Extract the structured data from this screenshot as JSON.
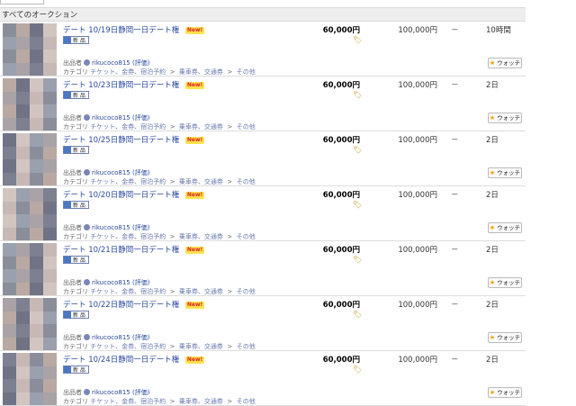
{
  "header": {
    "section_title": "すべてのオークション"
  },
  "items": [
    {
      "title": "デート 10/19日静岡一日デート権",
      "new_badge": "New!",
      "condition_tag": "新 品",
      "seller_prefix": "出品者",
      "seller_name": "rikucoco815",
      "seller_rating": "(評価)",
      "category_prefix": "カテゴリ",
      "category_path": [
        "チケット、金券、宿泊予約",
        "乗車券、交通券",
        "その他"
      ],
      "price": "60,000円",
      "buy_now": "100,000円",
      "bids": "－",
      "remaining": "10時間",
      "watch_label": "ウォッチ"
    },
    {
      "title": "デート 10/23日静岡一日デート権",
      "new_badge": "New!",
      "condition_tag": "新 品",
      "seller_prefix": "出品者",
      "seller_name": "rikucoco815",
      "seller_rating": "(評価)",
      "category_prefix": "カテゴリ",
      "category_path": [
        "チケット、金券、宿泊予約",
        "乗車券、交通券",
        "その他"
      ],
      "price": "60,000円",
      "buy_now": "100,000円",
      "bids": "－",
      "remaining": "2日",
      "watch_label": "ウォッチ"
    },
    {
      "title": "デート 10/25日静岡一日デート権",
      "new_badge": "New!",
      "condition_tag": "新 品",
      "seller_prefix": "出品者",
      "seller_name": "rikucoco815",
      "seller_rating": "(評価)",
      "category_prefix": "カテゴリ",
      "category_path": [
        "チケット、金券、宿泊予約",
        "乗車券、交通券",
        "その他"
      ],
      "price": "60,000円",
      "buy_now": "100,000円",
      "bids": "－",
      "remaining": "2日",
      "watch_label": "ウォッチ"
    },
    {
      "title": "デート 10/20日静岡一日デート権",
      "new_badge": "New!",
      "condition_tag": "新 品",
      "seller_prefix": "出品者",
      "seller_name": "rikucoco815",
      "seller_rating": "(評価)",
      "category_prefix": "カテゴリ",
      "category_path": [
        "チケット、金券、宿泊予約",
        "乗車券、交通券",
        "その他"
      ],
      "price": "60,000円",
      "buy_now": "100,000円",
      "bids": "－",
      "remaining": "2日",
      "watch_label": "ウォッチ"
    },
    {
      "title": "デート 10/21日静岡一日デート権",
      "new_badge": "New!",
      "condition_tag": "新 品",
      "seller_prefix": "出品者",
      "seller_name": "rikucoco815",
      "seller_rating": "(評価)",
      "category_prefix": "カテゴリ",
      "category_path": [
        "チケット、金券、宿泊予約",
        "乗車券、交通券",
        "その他"
      ],
      "price": "60,000円",
      "buy_now": "100,000円",
      "bids": "－",
      "remaining": "2日",
      "watch_label": "ウォッチ"
    },
    {
      "title": "デート 10/22日静岡一日デート権",
      "new_badge": "New!",
      "condition_tag": "新 品",
      "seller_prefix": "出品者",
      "seller_name": "rikucoco815",
      "seller_rating": "(評価)",
      "category_prefix": "カテゴリ",
      "category_path": [
        "チケット、金券、宿泊予約",
        "乗車券、交通券",
        "その他"
      ],
      "price": "60,000円",
      "buy_now": "100,000円",
      "bids": "－",
      "remaining": "2日",
      "watch_label": "ウォッチ"
    },
    {
      "title": "デート 10/24日静岡一日デート権",
      "new_badge": "New!",
      "condition_tag": "新 品",
      "seller_prefix": "出品者",
      "seller_name": "rikucoco815",
      "seller_rating": "(評価)",
      "category_prefix": "カテゴリ",
      "category_path": [
        "チケット、金券、宿泊予約",
        "乗車券、交通券",
        "その他"
      ],
      "price": "60,000円",
      "buy_now": "100,000円",
      "bids": "－",
      "remaining": "2日",
      "watch_label": "ウォッチ"
    }
  ],
  "colors": {
    "title_link": "#2a4a9e",
    "section_bg": "#eeeeee",
    "watch_star": "#f0a000"
  }
}
